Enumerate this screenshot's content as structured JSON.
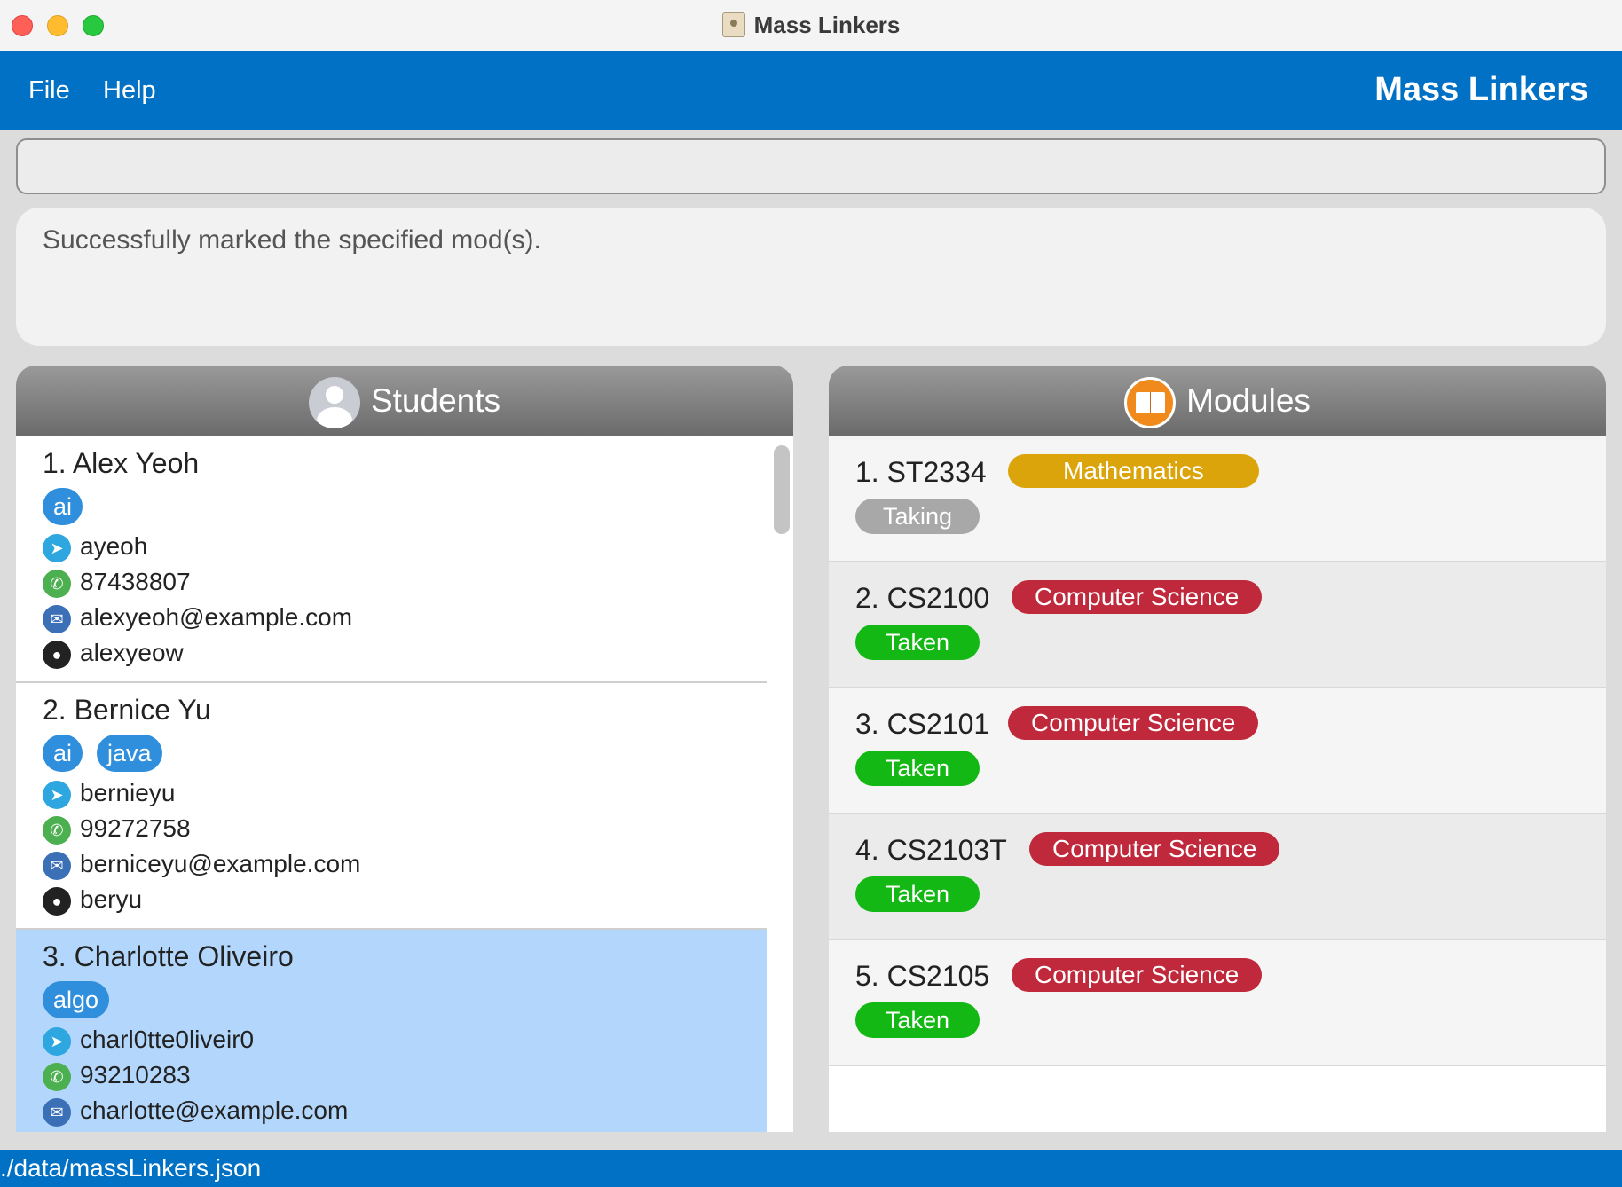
{
  "window": {
    "title": "Mass Linkers"
  },
  "menu": {
    "file": "File",
    "help": "Help",
    "brand": "Mass Linkers"
  },
  "command": {
    "value": ""
  },
  "result": {
    "message": "Successfully marked the specified mod(s)."
  },
  "students_panel": {
    "title": "Students",
    "items": [
      {
        "name": "1. Alex Yeoh",
        "tags": [
          "ai"
        ],
        "telegram": "ayeoh",
        "phone": "87438807",
        "email": "alexyeoh@example.com",
        "github": "alexyeow",
        "selected": false
      },
      {
        "name": "2. Bernice Yu",
        "tags": [
          "ai",
          "java"
        ],
        "telegram": "bernieyu",
        "phone": "99272758",
        "email": "berniceyu@example.com",
        "github": "beryu",
        "selected": false
      },
      {
        "name": "3. Charlotte Oliveiro",
        "tags": [
          "algo"
        ],
        "telegram": "charl0tte0liveir0",
        "phone": "93210283",
        "email": "charlotte@example.com",
        "github": "",
        "selected": true
      }
    ]
  },
  "modules_panel": {
    "title": "Modules",
    "items": [
      {
        "code": "1. ST2334",
        "department": "Mathematics",
        "status": "Taking"
      },
      {
        "code": "2. CS2100",
        "department": "Computer Science",
        "status": "Taken"
      },
      {
        "code": "3. CS2101",
        "department": "Computer Science",
        "status": "Taken"
      },
      {
        "code": "4. CS2103T",
        "department": "Computer Science",
        "status": "Taken"
      },
      {
        "code": "5. CS2105",
        "department": "Computer Science",
        "status": "Taken"
      }
    ]
  },
  "statusbar": {
    "path": "./data/massLinkers.json"
  },
  "colors": {
    "brand_blue": "#0071c5",
    "tag_blue": "#2f8fdc",
    "mathematics": "#dba40b",
    "computer_science": "#c0283b",
    "taken": "#14b814",
    "taking": "#a8a8a8",
    "selected_row": "#b3d7fc"
  }
}
